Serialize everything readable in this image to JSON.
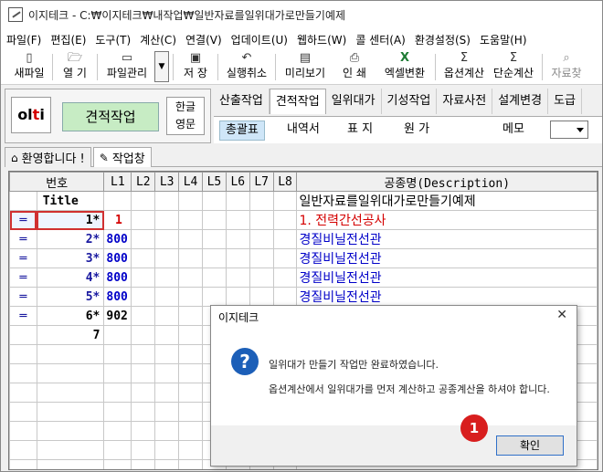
{
  "window": {
    "title": "이지테크 - C:₩이지테크₩내작업₩일반자료를일위대가로만들기예제"
  },
  "menu": [
    "파일(F)",
    "편집(E)",
    "도구(T)",
    "계산(C)",
    "연결(V)",
    "업데이트(U)",
    "웹하드(W)",
    "콜 센터(A)",
    "환경설정(S)",
    "도움말(H)"
  ],
  "toolbar": {
    "new_file": "새파일",
    "open": "열 기",
    "file_manage": "파일관리",
    "save": "저 장",
    "undo": "실행취소",
    "preview": "미리보기",
    "print": "인 쇄",
    "excel": "엑셀변환",
    "option_calc": "옵션계산",
    "simple_calc": "단순계산",
    "search_data": "자료찾"
  },
  "mode": {
    "logo": "olti",
    "current": "견적작업",
    "lang1": "한글",
    "lang2": "영문"
  },
  "tabs": [
    "산출작업",
    "견적작업",
    "일위대가",
    "기성작업",
    "자료사전",
    "설계변경",
    "도급"
  ],
  "subtabs": {
    "summary": "총괄표",
    "detail": "내역서",
    "cover": "표 지",
    "original": "원 가",
    "memo": "메모"
  },
  "doc_tabs": {
    "welcome": "환영합니다 !",
    "workspace": "작업창"
  },
  "grid": {
    "headers": [
      "번호",
      "L1",
      "L2",
      "L3",
      "L4",
      "L5",
      "L6",
      "L7",
      "L8",
      "공종명(Description)"
    ],
    "rows": [
      {
        "num": "Title",
        "l1": "",
        "desc": "일반자료를일위대가로만들기예제"
      },
      {
        "num": "1*",
        "l1": "1",
        "desc": "1. 전력간선공사"
      },
      {
        "num": "2*",
        "l1": "800",
        "desc": "경질비닐전선관"
      },
      {
        "num": "3*",
        "l1": "800",
        "desc": "경질비닐전선관"
      },
      {
        "num": "4*",
        "l1": "800",
        "desc": "경질비닐전선관"
      },
      {
        "num": "5*",
        "l1": "800",
        "desc": "경질비닐전선관"
      },
      {
        "num": "6*",
        "l1": "902",
        "desc": ""
      },
      {
        "num": "7",
        "l1": "",
        "desc": ""
      }
    ]
  },
  "dialog": {
    "title": "이지테크",
    "message1": "일위대가 만들기 작업만 완료하였습니다.",
    "message2": "옵션계산에서 일위대가를 먼저 계산하고 공종계산을 하셔야 합니다.",
    "ok": "확인"
  },
  "badge": "1"
}
